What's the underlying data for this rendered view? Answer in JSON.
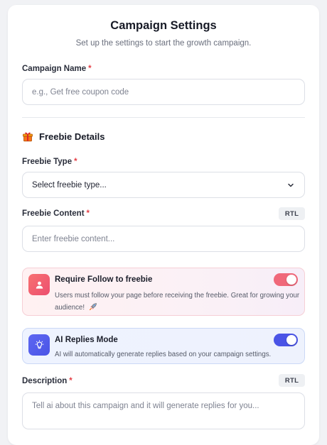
{
  "header": {
    "title": "Campaign Settings",
    "subtitle": "Set up the settings to start the growth campaign."
  },
  "campaign_name": {
    "label": "Campaign Name",
    "required_mark": "*",
    "placeholder": "e.g., Get free coupon code",
    "value": ""
  },
  "freebie_section": {
    "heading": "Freebie Details",
    "icon": "gift-icon"
  },
  "freebie_type": {
    "label": "Freebie Type",
    "required_mark": "*",
    "selected": "Select freebie type..."
  },
  "freebie_content": {
    "label": "Freebie Content",
    "required_mark": "*",
    "rtl_label": "RTL",
    "placeholder": "Enter freebie content...",
    "value": ""
  },
  "require_follow": {
    "title": "Require Follow to freebie",
    "description": "Users must follow your page before receiving the freebie. Great for growing your audience!",
    "icon": "user-icon",
    "enabled": true,
    "accent": "#f0687a"
  },
  "ai_replies": {
    "title": "AI Replies Mode",
    "description": "AI will automatically generate replies based on your campaign settings.",
    "icon": "lightbulb-icon",
    "enabled": true,
    "accent": "#4a54e6"
  },
  "description": {
    "label": "Description",
    "required_mark": "*",
    "rtl_label": "RTL",
    "placeholder": "Tell ai about this campaign and it will generate replies for you..."
  }
}
